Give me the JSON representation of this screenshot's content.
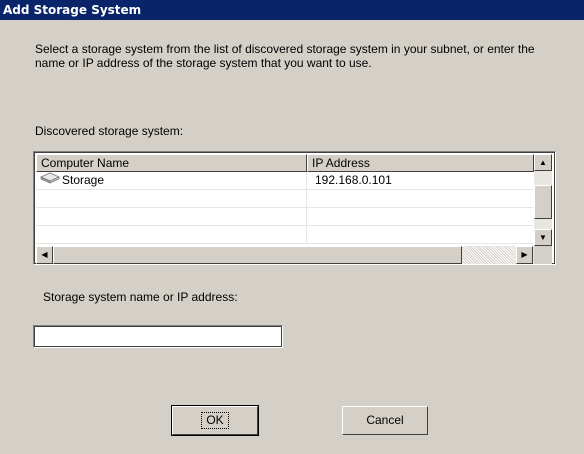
{
  "window": {
    "title": "Add Storage System"
  },
  "description": "Select a storage system from the list of discovered storage system in your subnet, or enter the name or IP address of the storage system that you want to use.",
  "discovered_label": "Discovered storage system:",
  "list": {
    "columns": [
      "Computer Name",
      "IP Address"
    ],
    "rows": [
      {
        "name": "Storage",
        "ip": "192.168.0.101",
        "icon": "storage-device-icon"
      }
    ]
  },
  "name_field": {
    "label": "Storage system name or IP address:",
    "value": ""
  },
  "buttons": {
    "ok": "OK",
    "cancel": "Cancel"
  },
  "colors": {
    "titlebar": "#0a246a",
    "dialog": "#d4d0c8"
  }
}
